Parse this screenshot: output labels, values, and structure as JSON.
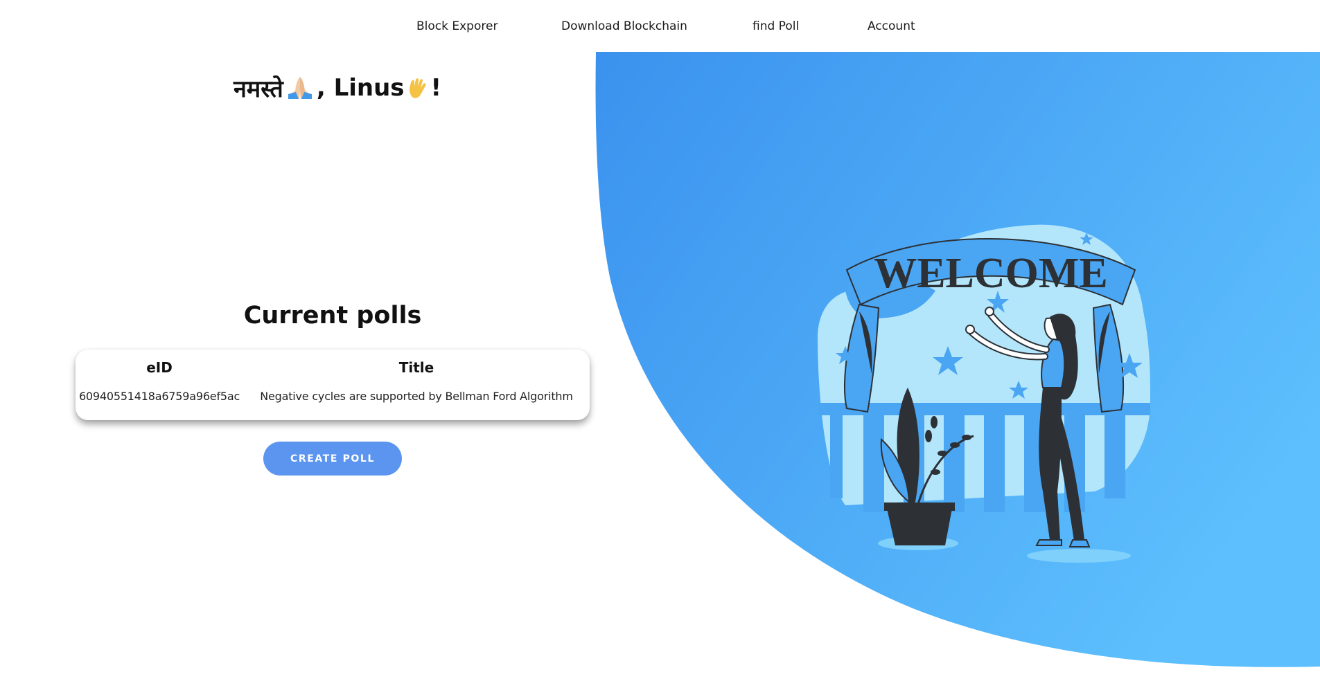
{
  "nav": {
    "items": [
      {
        "label": "Block Exporer"
      },
      {
        "label": "Download Blockchain"
      },
      {
        "label": "find Poll"
      },
      {
        "label": "Account"
      }
    ]
  },
  "greeting": {
    "prefix": "नमस्ते",
    "separator": ", Linus",
    "suffix": "!"
  },
  "polls": {
    "title": "Current polls",
    "columns": [
      "eID",
      "Title"
    ],
    "rows": [
      {
        "eid": "60940551418a6759a96ef5ac",
        "title": "Negative cycles are supported by Bellman Ford Algorithm"
      }
    ]
  },
  "create_button": {
    "label": "CREATE POLL"
  },
  "illustration": {
    "banner_text": "WELCOME"
  },
  "colors": {
    "accent": "#5b95ef",
    "hero_gradient_start": "#3d95ef",
    "hero_gradient_end": "#5cbcfc",
    "light_blue": "#b3e6fb",
    "dark": "#2d3136"
  }
}
